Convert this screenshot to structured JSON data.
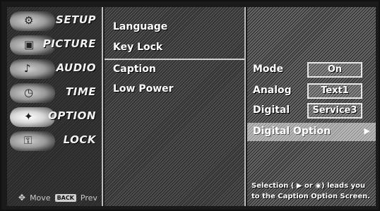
{
  "menu": {
    "items": [
      {
        "label": "SETUP",
        "icon": "setup-icon"
      },
      {
        "label": "PICTURE",
        "icon": "picture-icon"
      },
      {
        "label": "AUDIO",
        "icon": "audio-icon"
      },
      {
        "label": "TIME",
        "icon": "time-icon"
      },
      {
        "label": "OPTION",
        "icon": "option-icon"
      },
      {
        "label": "LOCK",
        "icon": "lock-icon"
      }
    ],
    "footer": {
      "move": "Move",
      "back_key": "BACK",
      "prev": "Prev"
    }
  },
  "options": {
    "items": [
      "Language",
      "Key Lock",
      "Caption",
      "Low Power"
    ]
  },
  "settings": {
    "mode": {
      "label": "Mode",
      "value": "On"
    },
    "analog": {
      "label": "Analog",
      "value": "Text1"
    },
    "digital": {
      "label": "Digital",
      "value": "Service3"
    },
    "digital_option": {
      "label": "Digital Option",
      "arrow": "▶"
    },
    "help_line1": "Selection ( ▶ or ◉) leads you",
    "help_line2": "to the Caption Option Screen."
  }
}
